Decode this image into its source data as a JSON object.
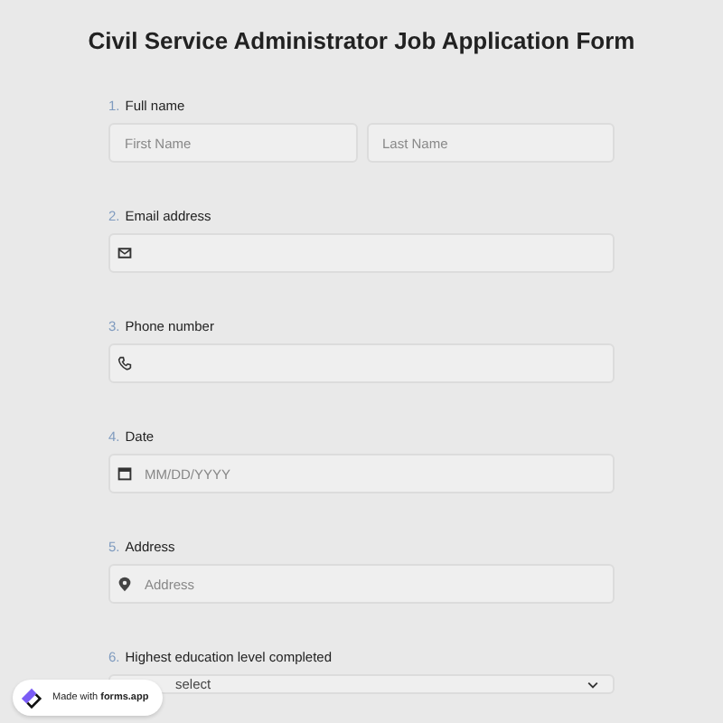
{
  "title": "Civil Service Administrator Job Application Form",
  "questions": [
    {
      "number": "1.",
      "label": "Full name",
      "kind": "name",
      "fields": [
        {
          "placeholder": "First Name"
        },
        {
          "placeholder": "Last Name"
        }
      ]
    },
    {
      "number": "2.",
      "label": "Email address",
      "kind": "email"
    },
    {
      "number": "3.",
      "label": "Phone number",
      "kind": "phone"
    },
    {
      "number": "4.",
      "label": "Date",
      "kind": "date",
      "placeholder": "MM/DD/YYYY"
    },
    {
      "number": "5.",
      "label": "Address",
      "kind": "address",
      "placeholder": "Address"
    },
    {
      "number": "6.",
      "label": "Highest education level completed",
      "kind": "select",
      "placeholder": "select"
    }
  ],
  "badge": {
    "text": "Made with **forms.app**"
  }
}
